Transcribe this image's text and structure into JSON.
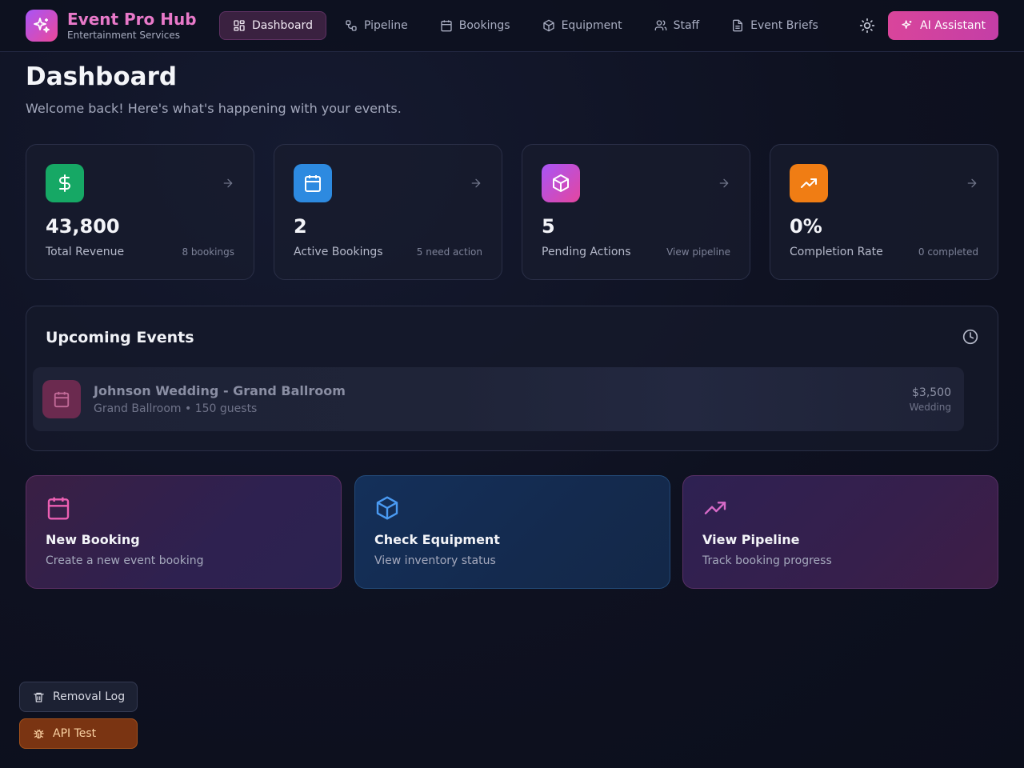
{
  "header": {
    "brand_title": "Event Pro Hub",
    "brand_subtitle": "Entertainment Services",
    "nav": [
      {
        "label": "Dashboard",
        "icon": "grid-icon",
        "active": true
      },
      {
        "label": "Pipeline",
        "icon": "workflow-icon",
        "active": false
      },
      {
        "label": "Bookings",
        "icon": "calendar-icon",
        "active": false
      },
      {
        "label": "Equipment",
        "icon": "box-icon",
        "active": false
      },
      {
        "label": "Staff",
        "icon": "users-icon",
        "active": false
      },
      {
        "label": "Event Briefs",
        "icon": "document-icon",
        "active": false
      }
    ],
    "ai_button": "AI Assistant"
  },
  "page": {
    "title": "Dashboard",
    "subtitle": "Welcome back! Here's what's happening with your events."
  },
  "stats": [
    {
      "value": "43,800",
      "label": "Total Revenue",
      "note": "8 bookings",
      "icon": "dollar-icon",
      "color": "#16a865"
    },
    {
      "value": "2",
      "label": "Active Bookings",
      "note": "5 need action",
      "icon": "calendar-icon",
      "color": "#2d8ae0"
    },
    {
      "value": "5",
      "label": "Pending Actions",
      "note": "View pipeline",
      "icon": "box-icon",
      "color": "#c144d9"
    },
    {
      "value": "0%",
      "label": "Completion Rate",
      "note": "0 completed",
      "icon": "trending-up-icon",
      "color": "#f07d14"
    }
  ],
  "upcoming": {
    "title": "Upcoming Events",
    "events": [
      {
        "name": "Johnson Wedding - Grand Ballroom",
        "meta": "Grand Ballroom • 150 guests",
        "price": "$3,500",
        "type": "Wedding"
      }
    ]
  },
  "actions": [
    {
      "title": "New Booking",
      "subtitle": "Create a new event booking",
      "icon": "calendar-icon",
      "color": "#ec5fb3"
    },
    {
      "title": "Check Equipment",
      "subtitle": "View inventory status",
      "icon": "box-icon",
      "color": "#4a9af2"
    },
    {
      "title": "View Pipeline",
      "subtitle": "Track booking progress",
      "icon": "trending-up-icon",
      "color": "#d86ac8"
    }
  ],
  "floating": {
    "removal_log": "Removal Log",
    "api_test": "API Test"
  }
}
